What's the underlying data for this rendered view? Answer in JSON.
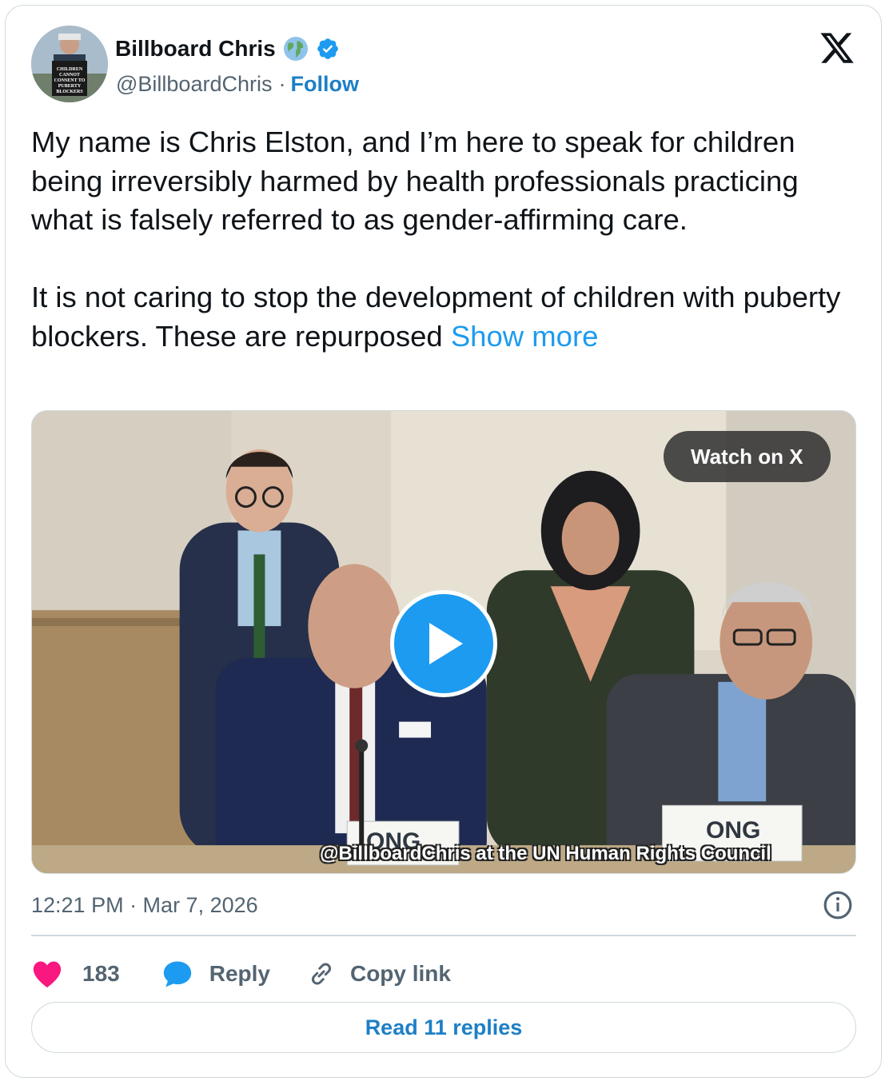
{
  "author": {
    "display_name": "Billboard Chris",
    "handle": "@BillboardChris",
    "separator": "·",
    "follow_label": "Follow",
    "avatar_sign_text": "CHILDREN CANNOT CONSENT TO PUBERTY BLOCKERS"
  },
  "tweet": {
    "text_p1": "My name is Chris Elston, and I’m here to speak for children being irreversibly harmed by health professionals practicing what is falsely referred to as gender-affirming care.",
    "text_p2": "It is not caring to stop the development of children with puberty blockers. These are repurposed ",
    "show_more": "Show more"
  },
  "media": {
    "watch_label": "Watch on X",
    "caption": "@BillboardChris at the UN Human Rights Council",
    "placard_left": "ONG",
    "placard_right": "ONG"
  },
  "meta": {
    "timestamp": "12:21 PM · Mar 7, 2026"
  },
  "actions": {
    "like_count": "183",
    "reply_label": "Reply",
    "copy_label": "Copy link",
    "read_replies_label": "Read 11 replies"
  },
  "colors": {
    "accent": "#1d9bf0",
    "like": "#f91880",
    "text": "#0f1419",
    "muted": "#536471",
    "border": "#cfd9de"
  },
  "icons": [
    "globe-emoji-icon",
    "verified-badge-icon",
    "x-logo-icon",
    "play-icon",
    "info-icon",
    "heart-icon",
    "reply-bubble-icon",
    "link-icon"
  ]
}
